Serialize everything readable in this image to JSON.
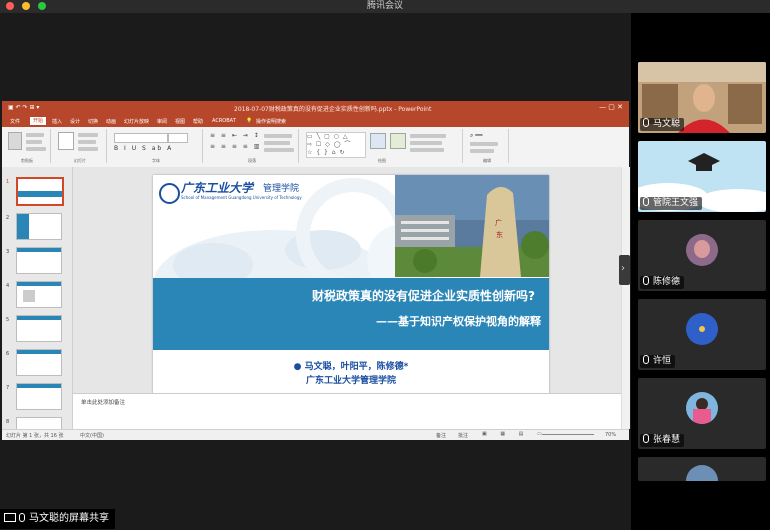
{
  "app": {
    "title": "腾讯会议"
  },
  "colors": {
    "ppt_accent": "#b7472a",
    "slide_band": "#2b86b8",
    "slide_text": "#1a4fa0"
  },
  "ppt": {
    "title_bar": "2018-07-07财税政策真的没有促进企业实质性创新吗.pptx - PowerPoint",
    "tabs": [
      "文件",
      "开始",
      "插入",
      "设计",
      "切换",
      "动画",
      "幻灯片放映",
      "审阅",
      "视图",
      "帮助",
      "ACROBAT",
      "操作说明搜索"
    ],
    "ribbon_groups": [
      "剪贴板",
      "幻灯片",
      "字体",
      "段落",
      "绘图",
      "编辑"
    ],
    "thumb_numbers": [
      "1",
      "2",
      "3",
      "4",
      "5",
      "6",
      "7",
      "8"
    ],
    "notes_text": "单击此处添加备注",
    "status_left": "幻灯片 第 1 张，共 16 张",
    "status_lang": "中文(中国)",
    "status_notes": "备注",
    "status_comments": "批注",
    "zoom": "70%"
  },
  "slide": {
    "school_cn": "广东工业大学",
    "school_dept": "管理学院",
    "school_en": "School of Management Guangdong University of Technology",
    "title": "财税政策真的没有促进企业实质性创新吗?",
    "subtitle": "——基于知识产权保护视角的解释",
    "authors": "马文聪，叶阳平，陈修德*",
    "affiliation": "广东工业大学管理学院"
  },
  "participants": [
    {
      "name": "马文聪"
    },
    {
      "name": "管院王文强"
    },
    {
      "name": "陈修德"
    },
    {
      "name": "许恒"
    },
    {
      "name": "张春慧"
    }
  ],
  "share_label": "马文聪的屏幕共享"
}
